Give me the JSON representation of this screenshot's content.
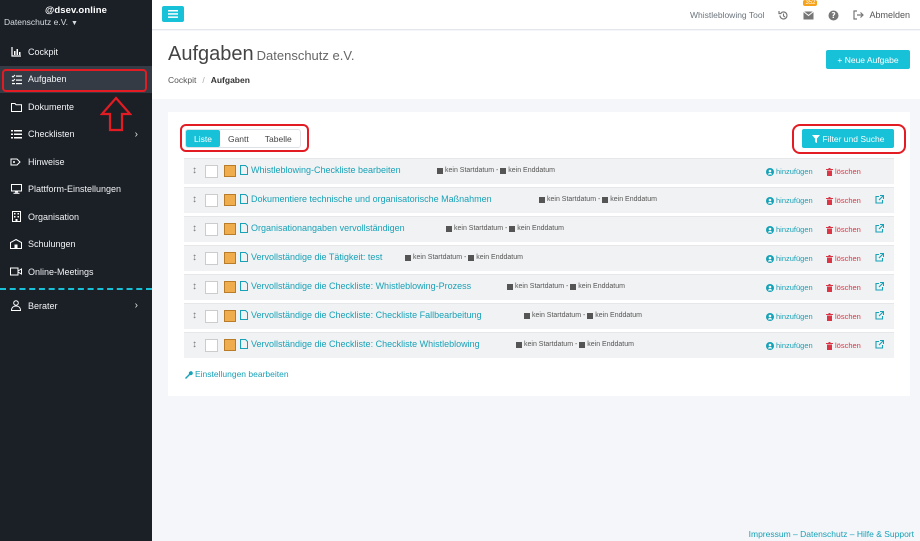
{
  "sidebar": {
    "brand": "@dsev.online",
    "org": "Datenschutz e.V.",
    "items": [
      {
        "label": "Cockpit"
      },
      {
        "label": "Aufgaben"
      },
      {
        "label": "Dokumente"
      },
      {
        "label": "Checklisten"
      },
      {
        "label": "Hinweise"
      },
      {
        "label": "Plattform-Einstellungen"
      },
      {
        "label": "Organisation"
      },
      {
        "label": "Schulungen"
      },
      {
        "label": "Online-Meetings"
      }
    ],
    "berater": "Berater"
  },
  "topbar": {
    "tool": "Whistleblowing Tool",
    "badge": "352",
    "logout": "Abmelden"
  },
  "header": {
    "title": "Aufgaben",
    "subtitle": "Datenschutz e.V.",
    "breadcrumb_root": "Cockpit",
    "breadcrumb_current": "Aufgaben",
    "new_button": "+ Neue Aufgabe"
  },
  "tabs": [
    "Liste",
    "Gantt",
    "Tabelle"
  ],
  "filter_button": "Filter und Suche",
  "tasks": [
    {
      "name": "Whistleblowing-Checkliste bearbeiten",
      "start": "kein Startdatum",
      "end": "kein Enddatum",
      "add": "hinzufügen",
      "del": "löschen"
    },
    {
      "name": "Dokumentiere technische und organisatorische Maßnahmen",
      "start": "kein Startdatum",
      "end": "kein Enddatum",
      "add": "hinzufügen",
      "del": "löschen"
    },
    {
      "name": "Organisationangaben vervollständigen",
      "start": "kein Startdatum",
      "end": "kein Enddatum",
      "add": "hinzufügen",
      "del": "löschen"
    },
    {
      "name": "Vervollständige die Tätigkeit: test",
      "start": "kein Startdatum",
      "end": "kein Enddatum",
      "add": "hinzufügen",
      "del": "löschen"
    },
    {
      "name": "Vervollständige die Checkliste: Whistleblowing-Prozess",
      "start": "kein Startdatum",
      "end": "kein Enddatum",
      "add": "hinzufügen",
      "del": "löschen"
    },
    {
      "name": "Vervollständige die Checkliste: Checkliste Fallbearbeitung",
      "start": "kein Startdatum",
      "end": "kein Enddatum",
      "add": "hinzufügen",
      "del": "löschen"
    },
    {
      "name": "Vervollständige die Checkliste: Checkliste Whistleblowing",
      "start": "kein Startdatum",
      "end": "kein Enddatum",
      "add": "hinzufügen",
      "del": "löschen"
    }
  ],
  "settings_link": "Einstellungen bearbeiten",
  "footer": "Impressum – Datenschutz – Hilfe & Support",
  "colors": {
    "accent": "#17c1d8",
    "sidebar": "#1b2027",
    "highlight": "#e31b23",
    "task_color": "#f0ad4e"
  }
}
